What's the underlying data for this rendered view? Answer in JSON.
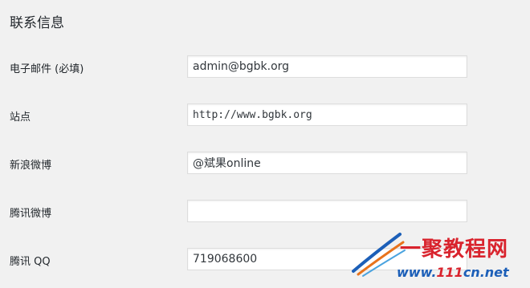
{
  "section": {
    "title": "联系信息"
  },
  "fields": [
    {
      "label": "电子邮件 (必填)",
      "value": "admin@bgbk.org"
    },
    {
      "label": "站点",
      "value": "http://www.bgbk.org"
    },
    {
      "label": "新浪微博",
      "value": "@斌果online"
    },
    {
      "label": "腾讯微博",
      "value": ""
    },
    {
      "label": "腾讯 QQ",
      "value": "719068600"
    }
  ],
  "watermark": {
    "title": "一聚教程网",
    "url_prefix": "www.",
    "url_111": "111",
    "url_suffix": "cn.net"
  },
  "colors": {
    "background": "#f1f1f1",
    "input_border": "#dddddd",
    "watermark_red": "#d9232d",
    "watermark_blue": "#1c5fb8"
  }
}
